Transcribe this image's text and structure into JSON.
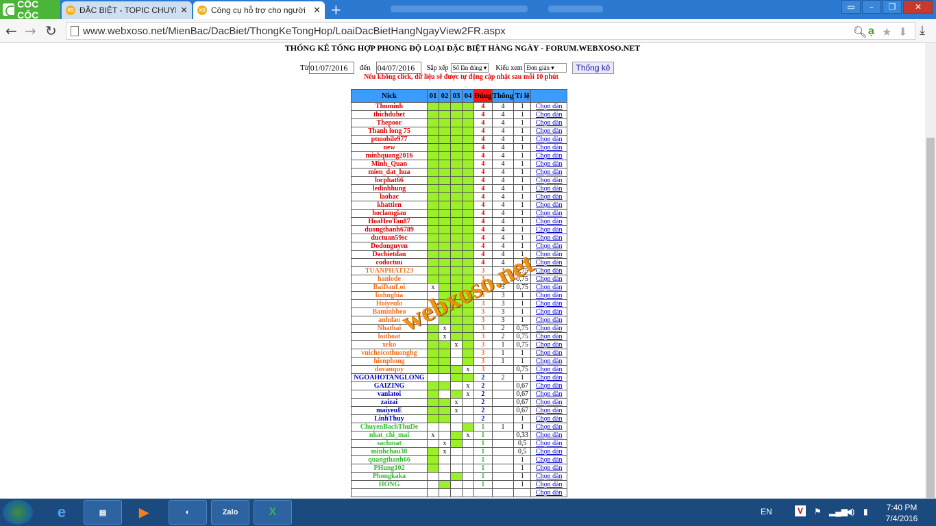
{
  "browser": {
    "brand": "CỐC CỐC",
    "tabs": [
      {
        "label": "ĐẶC BIỆT - TOPIC CHUYÊN",
        "favicon": "XS"
      },
      {
        "label": "Công cụ hỗ trợ cho người",
        "favicon": "XS"
      }
    ],
    "url": "www.webxoso.net/MienBac/DacBiet/ThongKeTongHop/LoaiDacBietHangNgayView2FR.aspx"
  },
  "page": {
    "title": "THỐNG KÊ TỔNG HỢP PHONG ĐỘ LOẠI ĐẶC BIỆT HÀNG NGÀY - FORUM.WEBXOSO.NET",
    "from_label": "Từ",
    "from_value": "01/07/2016",
    "to_label": "đến",
    "to_value": "04/07/2016",
    "sort_label": "Sắp xếp",
    "sort_value": "Số lần đúng",
    "view_label": "Kiểu xem",
    "view_value": "Đơn giản",
    "submit_label": "Thống kê",
    "note": "Nếu không click, dữ liệu sẽ được tự động cập nhật sau mỗi 10 phút",
    "watermark": "webxoso.net"
  },
  "table": {
    "headers": [
      "Nick",
      "01",
      "02",
      "03",
      "04",
      "Đúng",
      "Thông",
      "Tỉ lệ",
      ""
    ],
    "link_label": "Chọn dàn",
    "rows": [
      {
        "nick": "Thuminh",
        "c": [
          "g",
          "g",
          "g",
          "g"
        ],
        "d": "4",
        "t": "4",
        "r": "1",
        "col": "red"
      },
      {
        "nick": "thichduhet",
        "c": [
          "g",
          "g",
          "g",
          "g"
        ],
        "d": "4",
        "t": "4",
        "r": "1",
        "col": "red"
      },
      {
        "nick": "Thepoor",
        "c": [
          "g",
          "g",
          "g",
          "g"
        ],
        "d": "4",
        "t": "4",
        "r": "1",
        "col": "red"
      },
      {
        "nick": "Thanh long 75",
        "c": [
          "g",
          "g",
          "g",
          "g"
        ],
        "d": "4",
        "t": "4",
        "r": "1",
        "col": "red"
      },
      {
        "nick": "ptmobile977",
        "c": [
          "g",
          "g",
          "g",
          "g"
        ],
        "d": "4",
        "t": "4",
        "r": "1",
        "col": "red"
      },
      {
        "nick": "new",
        "c": [
          "g",
          "g",
          "g",
          "g"
        ],
        "d": "4",
        "t": "4",
        "r": "1",
        "col": "red"
      },
      {
        "nick": "minhquang2016",
        "c": [
          "g",
          "g",
          "g",
          "g"
        ],
        "d": "4",
        "t": "4",
        "r": "1",
        "col": "red"
      },
      {
        "nick": "Minh_Quan",
        "c": [
          "g",
          "g",
          "g",
          "g"
        ],
        "d": "4",
        "t": "4",
        "r": "1",
        "col": "red"
      },
      {
        "nick": "mien_dat_hua",
        "c": [
          "g",
          "g",
          "g",
          "g"
        ],
        "d": "4",
        "t": "4",
        "r": "1",
        "col": "red"
      },
      {
        "nick": "locphat66",
        "c": [
          "g",
          "g",
          "g",
          "g"
        ],
        "d": "4",
        "t": "4",
        "r": "1",
        "col": "red"
      },
      {
        "nick": "ledinhhung",
        "c": [
          "g",
          "g",
          "g",
          "g"
        ],
        "d": "4",
        "t": "4",
        "r": "1",
        "col": "red"
      },
      {
        "nick": "laohac",
        "c": [
          "g",
          "g",
          "g",
          "g"
        ],
        "d": "4",
        "t": "4",
        "r": "1",
        "col": "red"
      },
      {
        "nick": "khattien",
        "c": [
          "g",
          "g",
          "g",
          "g"
        ],
        "d": "4",
        "t": "4",
        "r": "1",
        "col": "red"
      },
      {
        "nick": "hoclamgiau",
        "c": [
          "g",
          "g",
          "g",
          "g"
        ],
        "d": "4",
        "t": "4",
        "r": "1",
        "col": "red"
      },
      {
        "nick": "HoaHeoTan87",
        "c": [
          "g",
          "g",
          "g",
          "g"
        ],
        "d": "4",
        "t": "4",
        "r": "1",
        "col": "red"
      },
      {
        "nick": "duongthanh6789",
        "c": [
          "g",
          "g",
          "g",
          "g"
        ],
        "d": "4",
        "t": "4",
        "r": "1",
        "col": "red"
      },
      {
        "nick": "ductuan59sc",
        "c": [
          "g",
          "g",
          "g",
          "g"
        ],
        "d": "4",
        "t": "4",
        "r": "1",
        "col": "red"
      },
      {
        "nick": "Dodonguyen",
        "c": [
          "g",
          "g",
          "g",
          "g"
        ],
        "d": "4",
        "t": "4",
        "r": "1",
        "col": "red"
      },
      {
        "nick": "Dacbietdan",
        "c": [
          "g",
          "g",
          "g",
          "g"
        ],
        "d": "4",
        "t": "4",
        "r": "1",
        "col": "red"
      },
      {
        "nick": "codoctuu",
        "c": [
          "g",
          "g",
          "g",
          "g"
        ],
        "d": "4",
        "t": "4",
        "r": "1",
        "col": "red"
      },
      {
        "nick": "TUANPHAT123",
        "c": [
          "g",
          "g",
          "g",
          "g"
        ],
        "d": "3",
        "t": "3",
        "r": "0,75",
        "col": "ora"
      },
      {
        "nick": "hanlode",
        "c": [
          "g",
          "g",
          "g",
          "g"
        ],
        "d": "3",
        "t": "3",
        "r": "0,75",
        "col": "ora"
      },
      {
        "nick": "BaiDauLoi",
        "c": [
          "x",
          "g",
          "g",
          "g"
        ],
        "d": "3",
        "t": "3",
        "r": "0,75",
        "col": "ora"
      },
      {
        "nick": "linhnghia",
        "c": [
          "",
          "g",
          "g",
          "g"
        ],
        "d": "3",
        "t": "3",
        "r": "1",
        "col": "ora"
      },
      {
        "nick": "Hoiyeulo",
        "c": [
          "",
          "g",
          "g",
          "g"
        ],
        "d": "3",
        "t": "3",
        "r": "1",
        "col": "ora"
      },
      {
        "nick": "Baminhbeo",
        "c": [
          "",
          "g",
          "g",
          "g"
        ],
        "d": "3",
        "t": "3",
        "r": "1",
        "col": "ora"
      },
      {
        "nick": "anhdao",
        "c": [
          "",
          "g",
          "g",
          "g"
        ],
        "d": "3",
        "t": "3",
        "r": "1",
        "col": "ora"
      },
      {
        "nick": "Nhathai",
        "c": [
          "g",
          "x",
          "g",
          "g"
        ],
        "d": "3",
        "t": "2",
        "r": "0,75",
        "col": "ora"
      },
      {
        "nick": "loithoat",
        "c": [
          "g",
          "x",
          "g",
          "g"
        ],
        "d": "3",
        "t": "2",
        "r": "0,75",
        "col": "ora"
      },
      {
        "nick": "xeko",
        "c": [
          "g",
          "g",
          "x",
          "g"
        ],
        "d": "3",
        "t": "1",
        "r": "0,75",
        "col": "ora"
      },
      {
        "nick": "vuichoicothuongbg",
        "c": [
          "g",
          "g",
          "",
          "g"
        ],
        "d": "3",
        "t": "1",
        "r": "1",
        "col": "ora"
      },
      {
        "nick": "hienphong",
        "c": [
          "g",
          "g",
          "",
          "g"
        ],
        "d": "3",
        "t": "1",
        "r": "1",
        "col": "ora"
      },
      {
        "nick": "dovanquy",
        "c": [
          "g",
          "g",
          "g",
          "x"
        ],
        "d": "3",
        "t": "",
        "r": "0,75",
        "col": "ora"
      },
      {
        "nick": "NGOAHOTANGLONG",
        "c": [
          "",
          "",
          "g",
          "g"
        ],
        "d": "2",
        "t": "2",
        "r": "1",
        "col": "blu"
      },
      {
        "nick": "GAIZING",
        "c": [
          "g",
          "g",
          "",
          "x"
        ],
        "d": "2",
        "t": "",
        "r": "0,67",
        "col": "blu"
      },
      {
        "nick": "vanlatoi",
        "c": [
          "g",
          "",
          "g",
          "x"
        ],
        "d": "2",
        "t": "",
        "r": "0,67",
        "col": "blu"
      },
      {
        "nick": "zaizai",
        "c": [
          "g",
          "g",
          "x",
          ""
        ],
        "d": "2",
        "t": "",
        "r": "0,67",
        "col": "blu"
      },
      {
        "nick": "maiyeuE",
        "c": [
          "g",
          "g",
          "x",
          ""
        ],
        "d": "2",
        "t": "",
        "r": "0,67",
        "col": "blu"
      },
      {
        "nick": "LinhThuy",
        "c": [
          "g",
          "g",
          "",
          ""
        ],
        "d": "2",
        "t": "",
        "r": "1",
        "col": "blu"
      },
      {
        "nick": "ChuyenBachThuDe",
        "c": [
          "",
          "",
          "",
          "g"
        ],
        "d": "1",
        "t": "1",
        "r": "1",
        "col": "grn"
      },
      {
        "nick": "nhat_chi_mai",
        "c": [
          "x",
          "",
          "g",
          "x"
        ],
        "d": "1",
        "t": "",
        "r": "0,33",
        "col": "grn"
      },
      {
        "nick": "sachmat",
        "c": [
          "",
          "x",
          "g",
          ""
        ],
        "d": "1",
        "t": "",
        "r": "0,5",
        "col": "grn"
      },
      {
        "nick": "minhchau38",
        "c": [
          "g",
          "x",
          "",
          ""
        ],
        "d": "1",
        "t": "",
        "r": "0,5",
        "col": "grn"
      },
      {
        "nick": "quangthanh66",
        "c": [
          "g",
          "",
          "",
          ""
        ],
        "d": "1",
        "t": "",
        "r": "1",
        "col": "grn"
      },
      {
        "nick": "PHung102",
        "c": [
          "g",
          "",
          "",
          ""
        ],
        "d": "1",
        "t": "",
        "r": "1",
        "col": "grn"
      },
      {
        "nick": "Phongkaka",
        "c": [
          "",
          "",
          "g",
          ""
        ],
        "d": "1",
        "t": "",
        "r": "1",
        "col": "grn"
      },
      {
        "nick": "HONG",
        "c": [
          "",
          "g",
          "",
          ""
        ],
        "d": "1",
        "t": "",
        "r": "1",
        "col": "grn"
      },
      {
        "nick": "",
        "c": [
          "",
          "",
          "",
          ""
        ],
        "d": "",
        "t": "",
        "r": "",
        "col": "grn"
      }
    ]
  },
  "taskbar": {
    "lang": "EN",
    "time": "7:40 PM",
    "date": "7/4/2016",
    "apps": [
      "ie-icon",
      "explorer-icon",
      "media-icon",
      "coccoc-icon",
      "Zalo",
      "excel-icon"
    ]
  }
}
